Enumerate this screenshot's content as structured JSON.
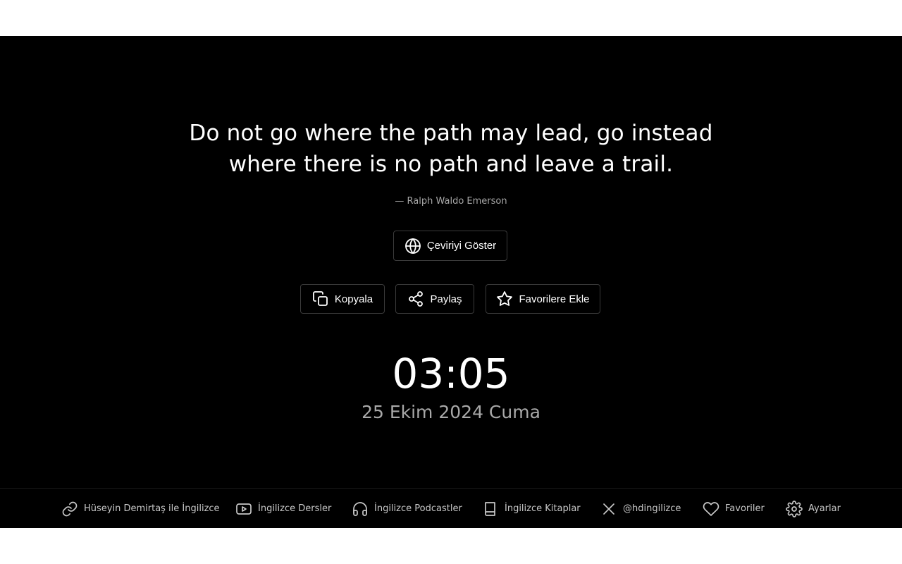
{
  "quote": {
    "line1": "Do not go where the path may lead, go instead",
    "line2": "where there is no path and leave a trail.",
    "author": "— Ralph Waldo Emerson"
  },
  "buttons": {
    "translate": {
      "label": "Çeviriyi Göster",
      "icon": "globe-icon"
    },
    "copy": {
      "label": "Kopyala",
      "icon": "copy-icon"
    },
    "share": {
      "label": "Paylaş",
      "icon": "share-icon"
    },
    "favorite": {
      "label": "Favorilere Ekle",
      "icon": "star-icon"
    }
  },
  "clock": {
    "time": "03:05",
    "date": "25 Ekim 2024 Cuma"
  },
  "footer": {
    "items": [
      {
        "label": "Hüseyin Demirtaş ile İngilizce",
        "icon": "link-icon"
      },
      {
        "label": "İngilizce Dersler",
        "icon": "youtube-icon"
      },
      {
        "label": "İngilizce Podcastler",
        "icon": "headphones-icon"
      },
      {
        "label": "İngilizce Kitaplar",
        "icon": "book-icon"
      },
      {
        "label": "@hdingilizce",
        "icon": "x-icon"
      },
      {
        "label": "Favoriler",
        "icon": "heart-icon"
      },
      {
        "label": "Ayarlar",
        "icon": "gear-icon"
      }
    ]
  },
  "colors": {
    "background": "#000000",
    "text": "#ffffff",
    "muted_text": "#a8a8a8",
    "button_border": "#3a3a3a"
  }
}
